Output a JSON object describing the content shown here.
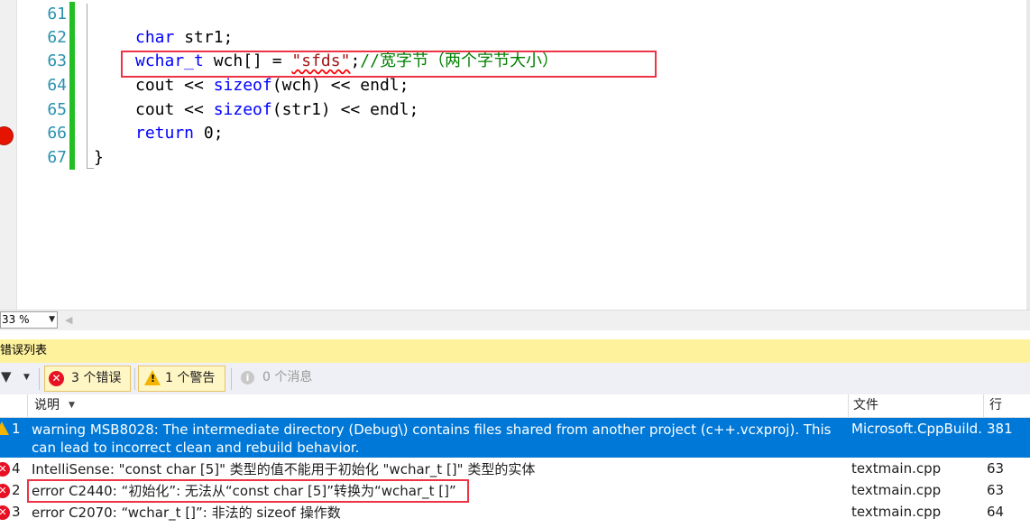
{
  "editor": {
    "lines": [
      {
        "number": "61",
        "tokens": []
      },
      {
        "number": "62",
        "tokens": [
          {
            "t": "char",
            "c": "kw"
          },
          {
            "t": " str1;",
            "c": ""
          }
        ]
      },
      {
        "number": "63",
        "tokens": [
          {
            "t": "wchar_t",
            "c": "kw"
          },
          {
            "t": " wch[] = ",
            "c": ""
          },
          {
            "t": "\"sfds\"",
            "c": "str"
          },
          {
            "t": ";",
            "c": ""
          },
          {
            "t": "//宽字节（两个字节大小）",
            "c": "cmt"
          }
        ]
      },
      {
        "number": "64",
        "tokens": [
          {
            "t": "cout << ",
            "c": ""
          },
          {
            "t": "sizeof",
            "c": "kw"
          },
          {
            "t": "(wch) << endl;",
            "c": ""
          }
        ]
      },
      {
        "number": "65",
        "tokens": [
          {
            "t": "cout << ",
            "c": ""
          },
          {
            "t": "sizeof",
            "c": "kw"
          },
          {
            "t": "(str1) << endl;",
            "c": ""
          }
        ]
      },
      {
        "number": "66",
        "tokens": [
          {
            "t": "return",
            "c": "kw"
          },
          {
            "t": " 0;",
            "c": ""
          }
        ]
      },
      {
        "number": "67",
        "tokens": [
          {
            "t": "}",
            "c": ""
          }
        ]
      }
    ],
    "breakpoint_line": "66",
    "zoom": "33 %"
  },
  "error_list": {
    "title": "错误列表",
    "filters": {
      "errors_count": "3",
      "errors_label": "个错误",
      "warnings_count": "1",
      "warnings_label": "个警告",
      "messages_count": "0",
      "messages_label": "个消息"
    },
    "columns": {
      "description": "说明",
      "file": "文件",
      "line": "行"
    },
    "rows": [
      {
        "type": "warning",
        "num": "1",
        "desc": "warning MSB8028: The intermediate directory (Debug\\) contains files shared from another project (c++.vcxproj).  This can lead to incorrect clean and rebuild behavior.",
        "file": "Microsoft.CppBuild.",
        "line": "381"
      },
      {
        "type": "error",
        "num": "4",
        "desc": "IntelliSense:  \"const char [5]\" 类型的值不能用于初始化 \"wchar_t []\" 类型的实体",
        "file": "textmain.cpp",
        "line": "63"
      },
      {
        "type": "error",
        "num": "2",
        "desc": "error C2440: “初始化”: 无法从“const char [5]”转换为“wchar_t []”",
        "file": "textmain.cpp",
        "line": "63"
      },
      {
        "type": "error",
        "num": "3",
        "desc": "error C2070: “wchar_t []”:  非法的 sizeof 操作数",
        "file": "textmain.cpp",
        "line": "64"
      }
    ]
  }
}
